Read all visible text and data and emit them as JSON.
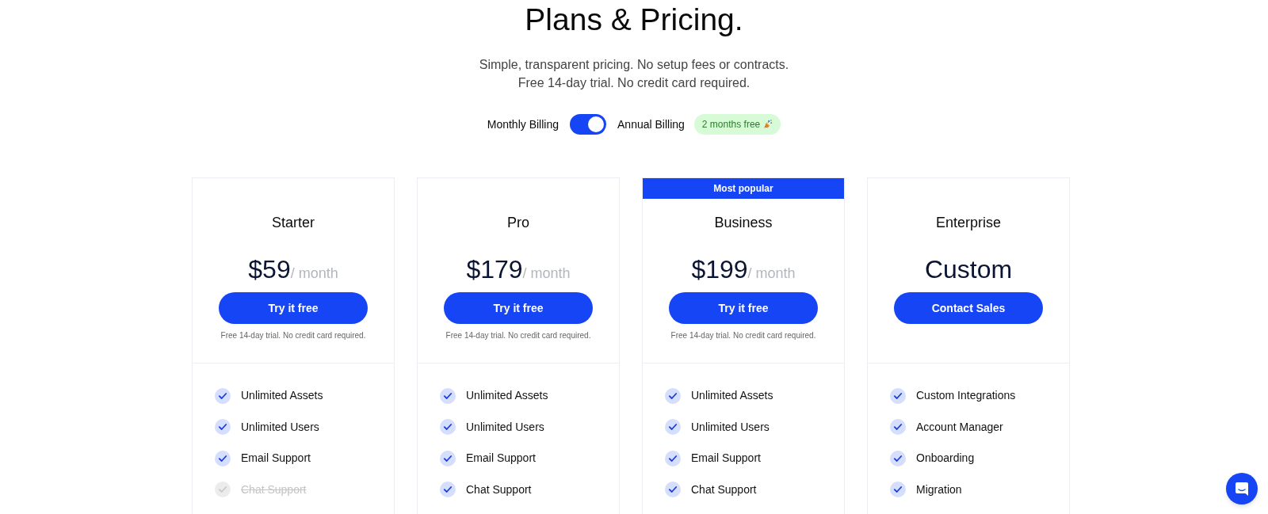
{
  "header": {
    "title": "Plans & Pricing.",
    "subtitle_lines": [
      "Simple, transparent pricing. No setup fees or contracts.",
      "Free 14-day trial. No credit card required."
    ]
  },
  "billing": {
    "monthly_label": "Monthly Billing",
    "annual_label": "Annual Billing",
    "on": true,
    "badge": "2 months free"
  },
  "plans": [
    {
      "name": "Starter",
      "price": {
        "amount": "$59",
        "period": "/ month"
      },
      "cta": "Try it free",
      "note": "Free 14-day trial. No credit card required.",
      "features": [
        {
          "label": "Unlimited Assets",
          "included": true
        },
        {
          "label": "Unlimited Users",
          "included": true
        },
        {
          "label": "Email Support",
          "included": true
        },
        {
          "label": "Chat Support",
          "included": false
        }
      ]
    },
    {
      "name": "Pro",
      "price": {
        "amount": "$179",
        "period": "/ month"
      },
      "cta": "Try it free",
      "note": "Free 14-day trial. No credit card required.",
      "features": [
        {
          "label": "Unlimited Assets",
          "included": true
        },
        {
          "label": "Unlimited Users",
          "included": true
        },
        {
          "label": "Email Support",
          "included": true
        },
        {
          "label": "Chat Support",
          "included": true
        }
      ]
    },
    {
      "name": "Business",
      "badge": "Most popular",
      "price": {
        "amount": "$199",
        "period": "/ month"
      },
      "cta": "Try it free",
      "note": "Free 14-day trial. No credit card required.",
      "features": [
        {
          "label": "Unlimited Assets",
          "included": true
        },
        {
          "label": "Unlimited Users",
          "included": true
        },
        {
          "label": "Email Support",
          "included": true
        },
        {
          "label": "Chat Support",
          "included": true
        }
      ]
    },
    {
      "name": "Enterprise",
      "price": {
        "amount": "Custom"
      },
      "cta": "Contact Sales",
      "features": [
        {
          "label": "Custom Integrations",
          "included": true
        },
        {
          "label": "Account Manager",
          "included": true
        },
        {
          "label": "Onboarding",
          "included": true
        },
        {
          "label": "Migration",
          "included": true
        }
      ]
    }
  ]
}
